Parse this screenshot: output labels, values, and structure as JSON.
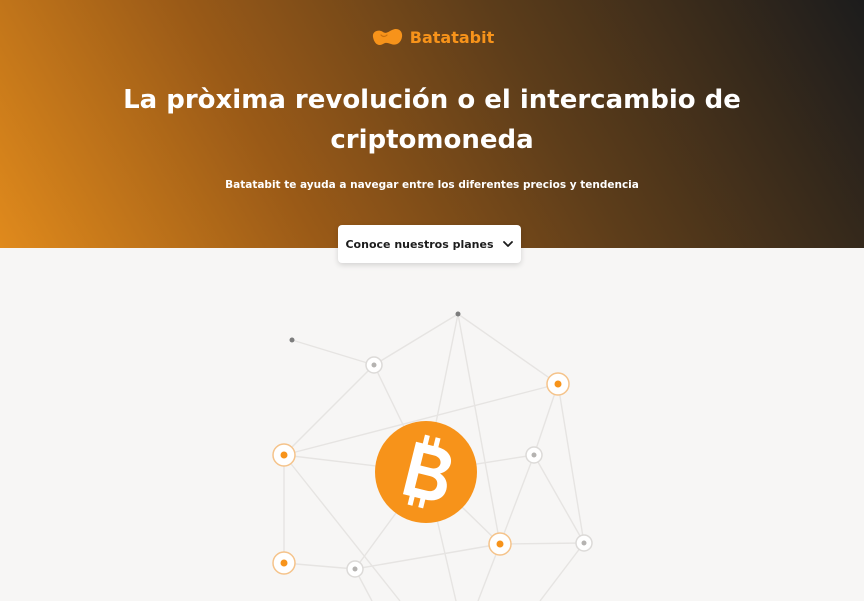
{
  "brand": {
    "name": "Batatabit",
    "logo_icon": "batata-logo-icon",
    "color": "#f7931a"
  },
  "hero": {
    "title": "La pròxima revolución o el intercambio de criptomoneda",
    "subtitle": "Batatabit te ayuda a navegar entre los diferentes precios y tendencia",
    "plans_button_label": "Conoce nuestros planes",
    "plans_button_icon": "chevron-down-icon"
  },
  "illustration": {
    "center_icon": "bitcoin-icon",
    "accent_color": "#f7931a",
    "line_color": "#e6e4e2"
  }
}
